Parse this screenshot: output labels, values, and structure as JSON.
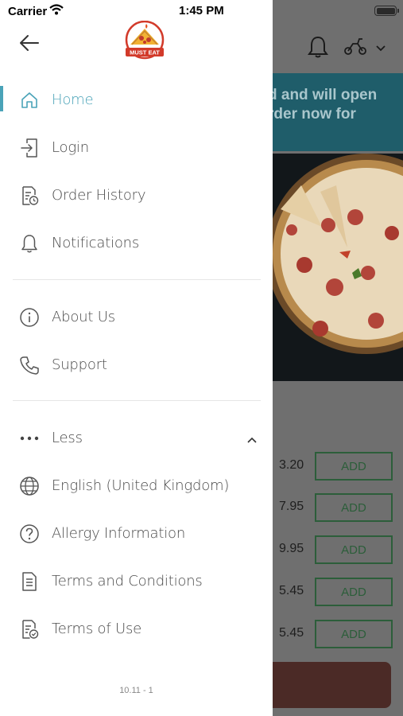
{
  "status_bar": {
    "carrier": "Carrier",
    "time": "1:45 PM"
  },
  "background": {
    "banner_text_line1": "d and will open",
    "banner_text_line2": "rder now for",
    "items": [
      {
        "price": "3.20",
        "add_label": "ADD"
      },
      {
        "price": "7.95",
        "add_label": "ADD"
      },
      {
        "price": "9.95",
        "add_label": "ADD"
      },
      {
        "price": "5.45",
        "add_label": "ADD"
      },
      {
        "price": "5.45",
        "add_label": "ADD"
      }
    ]
  },
  "drawer": {
    "logo_text": "MUST EAT",
    "menu_primary": [
      {
        "label": "Home",
        "icon": "home-icon",
        "active": true
      },
      {
        "label": "Login",
        "icon": "login-icon"
      },
      {
        "label": "Order History",
        "icon": "order-history-icon"
      },
      {
        "label": "Notifications",
        "icon": "bell-icon"
      }
    ],
    "menu_secondary": [
      {
        "label": "About Us",
        "icon": "info-icon"
      },
      {
        "label": "Support",
        "icon": "phone-icon"
      }
    ],
    "less_label": "Less",
    "menu_more": [
      {
        "label": "English (United Kingdom)",
        "icon": "globe-icon"
      },
      {
        "label": "Allergy Information",
        "icon": "question-icon"
      },
      {
        "label": "Terms and Conditions",
        "icon": "document-icon"
      },
      {
        "label": "Terms of Use",
        "icon": "document-check-icon"
      }
    ],
    "version": "10.11 - 1"
  },
  "colors": {
    "accent": "#4aa3b8",
    "text": "#4a4a4a",
    "add_button": "#2c5e3a"
  }
}
